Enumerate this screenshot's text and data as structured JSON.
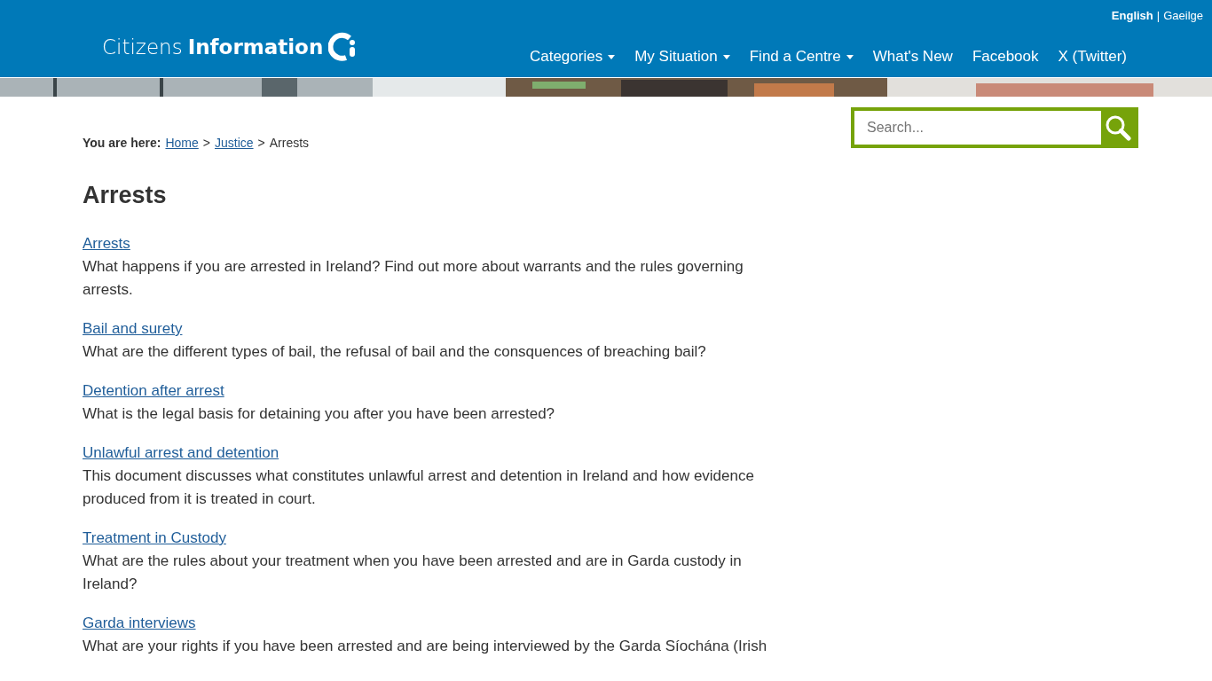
{
  "header": {
    "logo": {
      "light": "Citizens",
      "bold": "Information"
    },
    "languages": [
      {
        "label": "English",
        "selected": true
      },
      {
        "label": "Gaeilge",
        "selected": false
      }
    ],
    "language_separator": "|",
    "nav": [
      {
        "label": "Categories",
        "dropdown": true
      },
      {
        "label": "My Situation",
        "dropdown": true
      },
      {
        "label": "Find a Centre",
        "dropdown": true
      },
      {
        "label": "What's New",
        "dropdown": false
      },
      {
        "label": "Facebook",
        "dropdown": false
      },
      {
        "label": "X (Twitter)",
        "dropdown": false
      }
    ]
  },
  "search": {
    "placeholder": "Search..."
  },
  "breadcrumb": {
    "label": "You are here:",
    "separator": ">",
    "items": [
      {
        "label": "Home",
        "kind": "link"
      },
      {
        "label": "Justice",
        "kind": "link"
      },
      {
        "label": "Arrests",
        "kind": "current"
      }
    ]
  },
  "title": "Arrests",
  "articles": [
    {
      "title": "Arrests",
      "summary": "What happens if you are arrested in Ireland? Find out more about warrants and the rules governing arrests."
    },
    {
      "title": "Bail and surety",
      "summary": "What are the different types of bail, the refusal of bail and the consquences of breaching bail?"
    },
    {
      "title": "Detention after arrest",
      "summary": "What is the legal basis for detaining you after you have been arrested?"
    },
    {
      "title": "Unlawful arrest and detention",
      "summary": "This document discusses what constitutes unlawful arrest and detention in Ireland and how evidence produced from it is treated in court."
    },
    {
      "title": "Treatment in Custody",
      "summary": "What are the rules about your treatment when you have been arrested and are in Garda custody in Ireland?"
    },
    {
      "title": "Garda interviews",
      "summary": "What are your rights if you have been arrested and are being interviewed by the Garda Síochána (Irish"
    }
  ]
}
